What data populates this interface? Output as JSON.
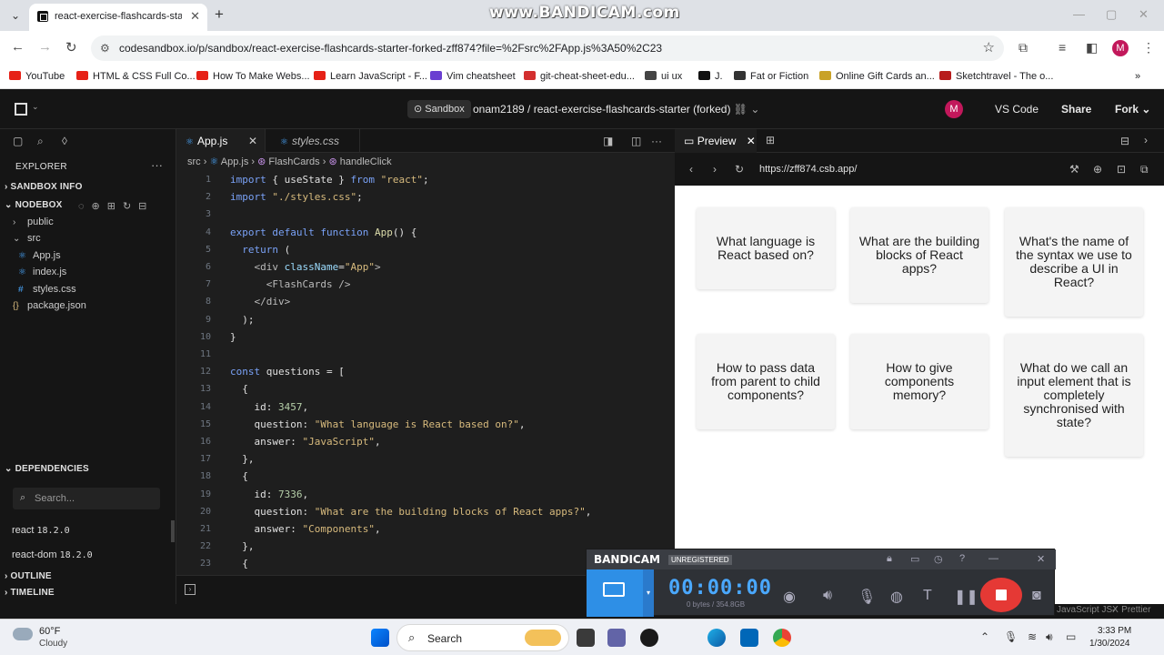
{
  "browser": {
    "tab_title": "react-exercise-flashcards-starter",
    "url": "codesandbox.io/p/sandbox/react-exercise-flashcards-starter-forked-zff874?file=%2Fsrc%2FApp.js%3A50%2C23",
    "profile_initial": "M",
    "watermark": "www.BANDICAM.com"
  },
  "bookmarks": [
    {
      "label": "YouTube",
      "color": "#e62117"
    },
    {
      "label": "HTML & CSS Full Co...",
      "color": "#e62117"
    },
    {
      "label": "How To Make Webs...",
      "color": "#e62117"
    },
    {
      "label": "Learn JavaScript - F...",
      "color": "#e62117"
    },
    {
      "label": "Vim cheatsheet",
      "color": "#6a3fd1"
    },
    {
      "label": "git-cheat-sheet-edu...",
      "color": "#d32f2f"
    },
    {
      "label": "ui ux",
      "color": "#444444"
    },
    {
      "label": "J.",
      "color": "#111111"
    },
    {
      "label": "Fat or Fiction",
      "color": "#333333"
    },
    {
      "label": "Online Gift Cards an...",
      "color": "#c9a227"
    },
    {
      "label": "Sketchtravel - The o...",
      "color": "#b71c1c"
    }
  ],
  "header": {
    "badge": "Sandbox",
    "title": "onam2189  /  react-exercise-flashcards-starter (forked)",
    "avatar": "M",
    "vscode": "VS Code",
    "share": "Share",
    "fork": "Fork"
  },
  "explorer": {
    "title": "EXPLORER",
    "sandbox_info": "SANDBOX INFO",
    "nodebox": "NODEBOX",
    "tree": [
      {
        "label": "public",
        "indent": 1,
        "kind": "folder"
      },
      {
        "label": "src",
        "indent": 1,
        "kind": "folder-open"
      },
      {
        "label": "App.js",
        "indent": 2,
        "kind": "react"
      },
      {
        "label": "index.js",
        "indent": 2,
        "kind": "react"
      },
      {
        "label": "styles.css",
        "indent": 2,
        "kind": "css"
      },
      {
        "label": "package.json",
        "indent": 1,
        "kind": "json"
      }
    ],
    "dependencies": "DEPENDENCIES",
    "search_placeholder": "Search...",
    "deps": [
      {
        "name": "react",
        "version": "18.2.0"
      },
      {
        "name": "react-dom",
        "version": "18.2.0"
      }
    ],
    "outline": "OUTLINE",
    "timeline": "TIMELINE"
  },
  "editor": {
    "tabs": [
      "App.js",
      "styles.css"
    ],
    "breadcrumb": [
      "src",
      "App.js",
      "FlashCards",
      "handleClick"
    ],
    "lines": [
      {
        "n": "1",
        "t": [
          [
            "kw",
            "import "
          ],
          [
            "plain",
            "{ useState } "
          ],
          [
            "kw",
            "from "
          ],
          [
            "str",
            "\"react\""
          ],
          [
            "plain",
            ";"
          ]
        ]
      },
      {
        "n": "2",
        "t": [
          [
            "kw",
            "import "
          ],
          [
            "str",
            "\"./styles.css\""
          ],
          [
            "plain",
            ";"
          ]
        ]
      },
      {
        "n": "3",
        "t": []
      },
      {
        "n": "4",
        "t": [
          [
            "kw",
            "export default function "
          ],
          [
            "fn",
            "App"
          ],
          [
            "plain",
            "() {"
          ]
        ]
      },
      {
        "n": "5",
        "t": [
          [
            "plain",
            "  "
          ],
          [
            "kw",
            "return "
          ],
          [
            "plain",
            "("
          ]
        ]
      },
      {
        "n": "6",
        "t": [
          [
            "plain",
            "    "
          ],
          [
            "tag",
            "<div "
          ],
          [
            "attr",
            "className"
          ],
          [
            "plain",
            "="
          ],
          [
            "str",
            "\"App\""
          ],
          [
            "tag",
            ">"
          ]
        ]
      },
      {
        "n": "7",
        "t": [
          [
            "plain",
            "      "
          ],
          [
            "tag",
            "<FlashCards />"
          ]
        ]
      },
      {
        "n": "8",
        "t": [
          [
            "plain",
            "    "
          ],
          [
            "tag",
            "</div>"
          ]
        ]
      },
      {
        "n": "9",
        "t": [
          [
            "plain",
            "  );"
          ]
        ]
      },
      {
        "n": "10",
        "t": [
          [
            "plain",
            "}"
          ]
        ]
      },
      {
        "n": "11",
        "t": []
      },
      {
        "n": "12",
        "t": [
          [
            "kw",
            "const "
          ],
          [
            "plain",
            "questions = ["
          ]
        ]
      },
      {
        "n": "13",
        "t": [
          [
            "plain",
            "  {"
          ]
        ]
      },
      {
        "n": "14",
        "t": [
          [
            "plain",
            "    id: "
          ],
          [
            "num",
            "3457"
          ],
          [
            "plain",
            ","
          ]
        ]
      },
      {
        "n": "15",
        "t": [
          [
            "plain",
            "    question: "
          ],
          [
            "str",
            "\"What language is React based on?\""
          ],
          [
            "plain",
            ","
          ]
        ]
      },
      {
        "n": "16",
        "t": [
          [
            "plain",
            "    answer: "
          ],
          [
            "str",
            "\"JavaScript\""
          ],
          [
            "plain",
            ","
          ]
        ]
      },
      {
        "n": "17",
        "t": [
          [
            "plain",
            "  },"
          ]
        ]
      },
      {
        "n": "18",
        "t": [
          [
            "plain",
            "  {"
          ]
        ]
      },
      {
        "n": "19",
        "t": [
          [
            "plain",
            "    id: "
          ],
          [
            "num",
            "7336"
          ],
          [
            "plain",
            ","
          ]
        ]
      },
      {
        "n": "20",
        "t": [
          [
            "plain",
            "    question: "
          ],
          [
            "str",
            "\"What are the building blocks of React apps?\""
          ],
          [
            "plain",
            ","
          ]
        ]
      },
      {
        "n": "21",
        "t": [
          [
            "plain",
            "    answer: "
          ],
          [
            "str",
            "\"Components\""
          ],
          [
            "plain",
            ","
          ]
        ]
      },
      {
        "n": "22",
        "t": [
          [
            "plain",
            "  },"
          ]
        ]
      },
      {
        "n": "23",
        "t": [
          [
            "plain",
            "  {"
          ]
        ]
      }
    ]
  },
  "preview": {
    "tab": "Preview",
    "url": "https://zff874.csb.app/",
    "cards": [
      "What language is React based on?",
      "What are the building blocks of React apps?",
      "What's the name of the syntax we use to describe a UI in React?",
      "How to pass data from parent to child components?",
      "How to give components memory?",
      "What do we call an input element that is completely synchronised with state?"
    ]
  },
  "status": {
    "lang": "JavaScript JSX",
    "formatter": "Prettier"
  },
  "bandicam": {
    "logo": "BANDICAM",
    "unregistered": "UNREGISTERED",
    "timer": "00:00:00",
    "size": "0 bytes / 354.8GB"
  },
  "taskbar": {
    "temp": "60°F",
    "condition": "Cloudy",
    "search": "Search",
    "time": "3:33 PM",
    "date": "1/30/2024"
  }
}
